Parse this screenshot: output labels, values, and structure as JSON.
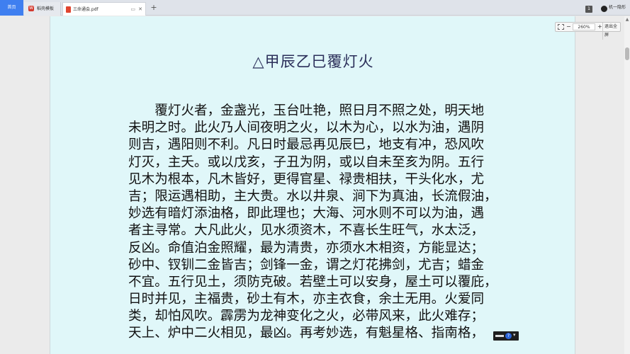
{
  "tabs": {
    "home_label": "首页",
    "template_label": "稻壳模板",
    "template_icon_glyph": "W",
    "pdf_label": "三命通会.pdf",
    "new_tab_label": "+",
    "pin_icon": "pin-icon",
    "close_icon": "close-icon"
  },
  "titlebar": {
    "badge": "1",
    "user_name": "机一隐形"
  },
  "zoom": {
    "minus": "−",
    "level": "260%",
    "plus": "+",
    "exit_fullscreen": "退出全屏"
  },
  "document": {
    "title": "△甲辰乙巳覆灯火",
    "lines": [
      "　　覆灯火者，金盏光，玉台吐艳，照日月不照之处，明天地",
      "未明之时。此火乃人间夜明之火，以木为心，以水为油，遇阴",
      "则吉，遇阳则不利。凡日时最忌再见辰巳，地支有冲，恐风吹",
      "灯灭，主夭。或以戊亥，子丑为阴，或以自未至亥为阴。五行",
      "见木为根本，凡木皆好，更得官星、禄贵相扶，干头化水，尤",
      "吉；限运遇相助，主大贵。水以井泉、涧下为真油，长流假油，",
      "妙选有暗灯添油格，即此理也；大海、河水则不可以为油，遇",
      "者主寻常。大凡此火，见水须资木，不喜长生旺气，水太泛，",
      "反凶。命值泊金照耀，最为清贵，亦须水木相资，方能显达；",
      "砂中、钗钏二金皆吉；剑锋一金，谓之灯花拂剑，尤吉；蜡金",
      "不宜。五行见土，须防克破。若壁土可以安身，屋土可以覆庇，",
      "日时并见，主福贵，砂土有木，亦主衣食，余土无用。火爱同",
      "类，却怕风吹。霹雳为龙神变化之火，必带风来，此火难存；",
      "天上、炉中二火相见，最凶。再考妙选，有魁星格、指南格，"
    ]
  },
  "mini_panel": {
    "help_glyph": "?"
  },
  "colors": {
    "page_background": "#e0f7f9",
    "home_tab": "#3f7ff0",
    "title_text": "#2b2f5a"
  }
}
